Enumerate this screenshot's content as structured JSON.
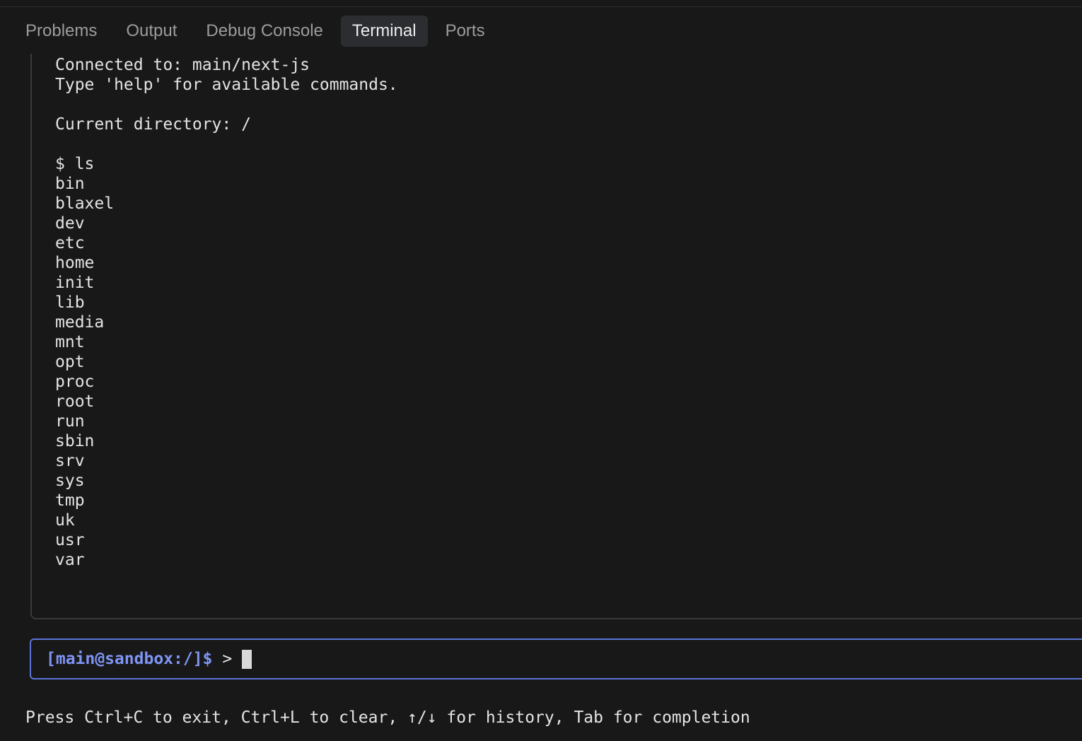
{
  "tabs": [
    {
      "label": "Problems",
      "active": false
    },
    {
      "label": "Output",
      "active": false
    },
    {
      "label": "Debug Console",
      "active": false
    },
    {
      "label": "Terminal",
      "active": true
    },
    {
      "label": "Ports",
      "active": false
    }
  ],
  "terminal": {
    "output_lines": [
      "Connected to: main/next-js",
      "Type 'help' for available commands.",
      "",
      "Current directory: /",
      "",
      "$ ls",
      "bin",
      "blaxel",
      "dev",
      "etc",
      "home",
      "init",
      "lib",
      "media",
      "mnt",
      "opt",
      "proc",
      "root",
      "run",
      "sbin",
      "srv",
      "sys",
      "tmp",
      "uk",
      "usr",
      "var"
    ],
    "prompt": "[main@sandbox:/]$",
    "prompt_arrow": ">",
    "input_value": "",
    "hint": "Press Ctrl+C to exit, Ctrl+L to clear, ↑/↓ for history, Tab for completion"
  },
  "colors": {
    "background": "#181818",
    "prompt": "#7f95f5",
    "input_border": "#5b74d8",
    "active_tab_bg": "#2b2d31"
  }
}
